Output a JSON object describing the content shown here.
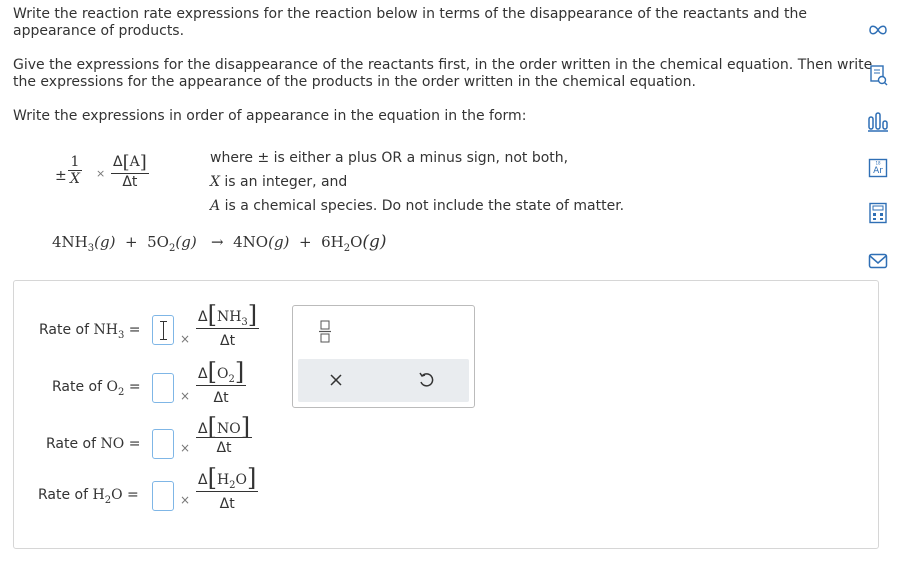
{
  "instructions": {
    "p1_line1": "Write the reaction rate expressions for the reaction below in terms of the disappearance of the reactants and the",
    "p1_line2": "appearance of products.",
    "p2_line1": "Give the expressions for the disappearance of the reactants first, in the order written in the chemical equation. Then write",
    "p2_line2": "the expressions for the appearance of the products in the order written in the chemical equation.",
    "p3": "Write the expressions in order of appearance in the equation in the form:"
  },
  "form": {
    "sign": "±",
    "one": "1",
    "x_var": "X",
    "times": "×",
    "delta_a": "Δ",
    "a_var": "A",
    "delta_t": "Δt",
    "where_line1": "where ± is either a plus OR a minus sign, not both,",
    "where_line2_var": "X",
    "where_line2_text": " is an integer, and",
    "where_line3_var": "A",
    "where_line3_text": " is a chemical species. Do not include the state of matter."
  },
  "equation": {
    "coef_nh3": "4",
    "coef_o2": "5",
    "coef_no": "4",
    "coef_h2o": "6",
    "state": "(g)",
    "plus": "+",
    "arrow": "→"
  },
  "rates": [
    {
      "label": "Rate of ",
      "species": "NH",
      "sub": "3",
      "eq": "=",
      "delta": "Δ",
      "dt": "Δt",
      "times": "×"
    },
    {
      "label": "Rate of ",
      "species": "O",
      "sub": "2",
      "eq": "=",
      "delta": "Δ",
      "dt": "Δt",
      "times": "×"
    },
    {
      "label": "Rate of ",
      "species": "NO",
      "sub": "",
      "eq": "=",
      "delta": "Δ",
      "dt": "Δt",
      "times": "×"
    },
    {
      "label": "Rate of ",
      "species": "H",
      "sub": "2",
      "species2": "O",
      "eq": "=",
      "delta": "Δ",
      "dt": "Δt",
      "times": "×"
    }
  ],
  "toolbox": {
    "clear_icon": "close-icon",
    "undo_icon": "undo-icon",
    "fraction_icon": "fraction-icon"
  },
  "sidebar": [
    "infinity-icon",
    "explanation-icon",
    "chart-icon",
    "periodic-table-icon",
    "calculator-icon",
    "mail-icon"
  ],
  "colors": {
    "accent": "#2f6fb5",
    "box_border": "#7fb6e6",
    "panel_border": "#d6d6d6",
    "toolbox_bg": "#e9ecef"
  }
}
